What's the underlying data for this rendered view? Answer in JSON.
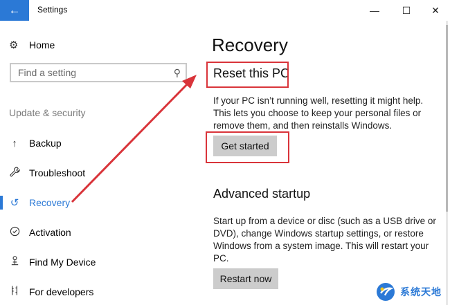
{
  "window": {
    "title": "Settings",
    "back_glyph": "←",
    "minimize_glyph": "—",
    "maximize_glyph": "☐",
    "close_glyph": "✕"
  },
  "sidebar": {
    "home_label": "Home",
    "search_placeholder": "Find a setting",
    "section_label": "Update & security",
    "items": [
      {
        "label": "Backup",
        "icon": "upload-arrow-icon",
        "glyph": "↑"
      },
      {
        "label": "Troubleshoot",
        "icon": "wrench-icon",
        "glyph": "🔧"
      },
      {
        "label": "Recovery",
        "icon": "history-icon",
        "glyph": "↺",
        "selected": true
      },
      {
        "label": "Activation",
        "icon": "check-circle-icon",
        "glyph": "✓"
      },
      {
        "label": "Find My Device",
        "icon": "person-pin-icon",
        "glyph": "♙"
      },
      {
        "label": "For developers",
        "icon": "developer-tools-icon",
        "glyph": "⚙"
      }
    ]
  },
  "main": {
    "page_title": "Recovery",
    "reset": {
      "title": "Reset this PC",
      "lines": [
        "If your PC isn’t running well, resetting it might help.",
        "This lets you choose to keep your personal files or",
        "remove them, and then reinstalls Windows."
      ],
      "button": "Get started"
    },
    "advanced": {
      "title": "Advanced startup",
      "lines": [
        "Start up from a device or disc (such as a USB drive or",
        "DVD), change Windows startup settings, or restore",
        "Windows from a system image. This will restart your",
        "PC."
      ],
      "button": "Restart now"
    }
  },
  "colors": {
    "accent": "#2b79d6",
    "annotation": "#d9343a",
    "button_bg": "#cccccc"
  },
  "watermark": {
    "text": "系统天地"
  }
}
